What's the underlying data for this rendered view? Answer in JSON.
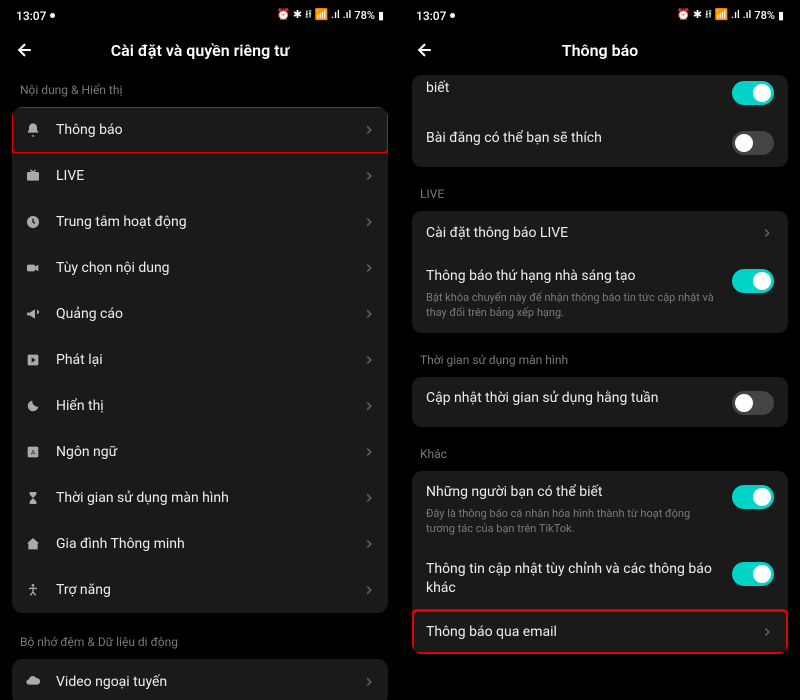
{
  "status_bar": {
    "time": "13:07",
    "battery": "78%"
  },
  "left": {
    "header_title": "Cài đặt và quyền riêng tư",
    "section1_label": "Nội dung & Hiển thị",
    "items": [
      {
        "icon": "bell",
        "label": "Thông báo"
      },
      {
        "icon": "tv",
        "label": "LIVE"
      },
      {
        "icon": "clock",
        "label": "Trung tâm hoạt động"
      },
      {
        "icon": "video",
        "label": "Tùy chọn nội dung"
      },
      {
        "icon": "megaphone",
        "label": "Quảng cáo"
      },
      {
        "icon": "play",
        "label": "Phát lại"
      },
      {
        "icon": "moon",
        "label": "Hiển thị"
      },
      {
        "icon": "language",
        "label": "Ngôn ngữ"
      },
      {
        "icon": "hourglass",
        "label": "Thời gian sử dụng màn hình"
      },
      {
        "icon": "home",
        "label": "Gia đình Thông minh"
      },
      {
        "icon": "accessibility",
        "label": "Trợ năng"
      }
    ],
    "section2_label": "Bộ nhớ đệm & Dữ liệu di động",
    "items2": [
      {
        "icon": "cloud",
        "label": "Video ngoại tuyến"
      }
    ]
  },
  "right": {
    "header_title": "Thông báo",
    "partial_item1_label": "biết",
    "partial_item2_label": "Bài đăng có thể bạn sẽ thích",
    "section_live": "LIVE",
    "live_settings": "Cài đặt thông báo LIVE",
    "creator_rank_title": "Thông báo thứ hạng nhà sáng tạo",
    "creator_rank_desc": "Bật khóa chuyển này để nhận thông báo tin tức cập nhật và thay đổi trên bảng xếp hạng.",
    "section_screen": "Thời gian sử dụng màn hình",
    "weekly_update": "Cập nhật thời gian sử dụng hằng tuần",
    "section_other": "Khác",
    "people_know_title": "Những người bạn có thể biết",
    "people_know_desc": "Đây là thông báo cá nhân hóa hình thành từ hoạt động tương tác của bạn trên TikTok.",
    "custom_updates": "Thông tin cập nhật tùy chỉnh và các thông báo khác",
    "email_notif": "Thông báo qua email"
  }
}
